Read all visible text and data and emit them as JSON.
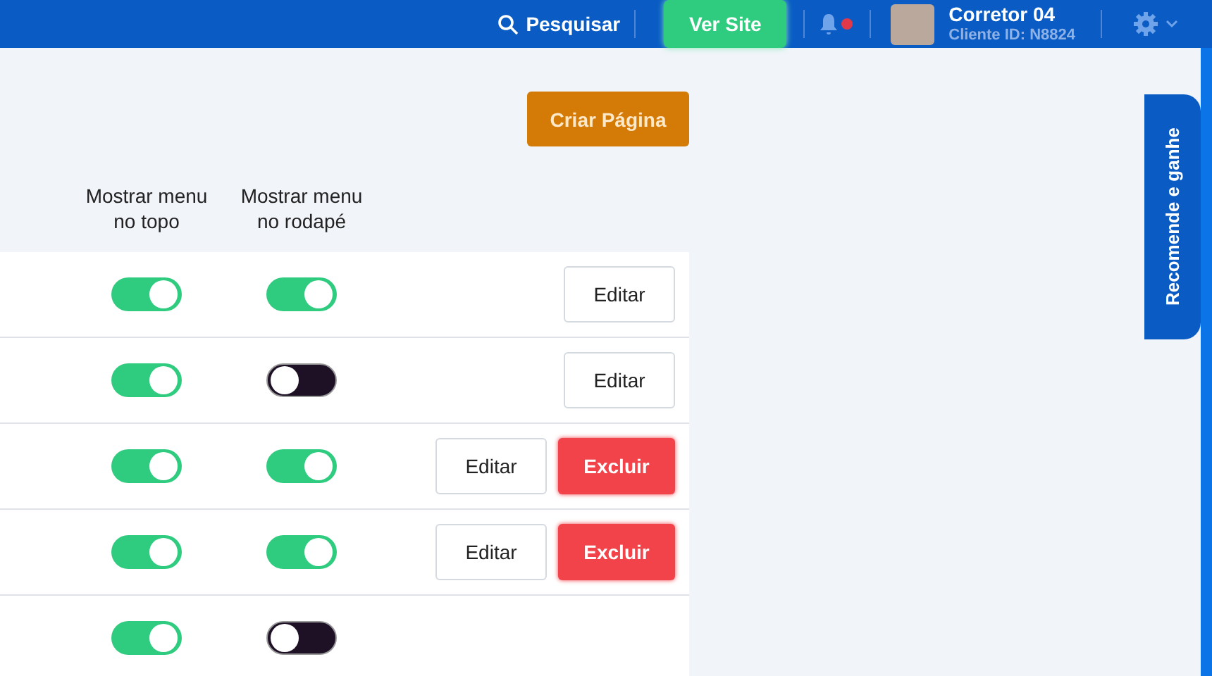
{
  "header": {
    "search_label": "Pesquisar",
    "view_site_button": "Ver Site",
    "user": {
      "name": "Corretor 04",
      "client_id": "Cliente ID: N8824"
    }
  },
  "create_button": "Criar Página",
  "columns": [
    {
      "label": "Mostrar menu no topo"
    },
    {
      "label": "Mostrar menu no rodapé"
    }
  ],
  "rows": [
    {
      "show_top": true,
      "show_footer": true,
      "actions": [
        {
          "kind": "edit",
          "label": "Editar"
        }
      ]
    },
    {
      "show_top": true,
      "show_footer": false,
      "actions": [
        {
          "kind": "edit",
          "label": "Editar"
        }
      ]
    },
    {
      "show_top": true,
      "show_footer": true,
      "actions": [
        {
          "kind": "edit",
          "label": "Editar"
        },
        {
          "kind": "delete",
          "label": "Excluir"
        }
      ]
    },
    {
      "show_top": true,
      "show_footer": true,
      "actions": [
        {
          "kind": "edit",
          "label": "Editar"
        },
        {
          "kind": "delete",
          "label": "Excluir"
        }
      ]
    },
    {
      "show_top": true,
      "show_footer": false,
      "actions": []
    }
  ],
  "side_tab": "Recomende e ganhe"
}
